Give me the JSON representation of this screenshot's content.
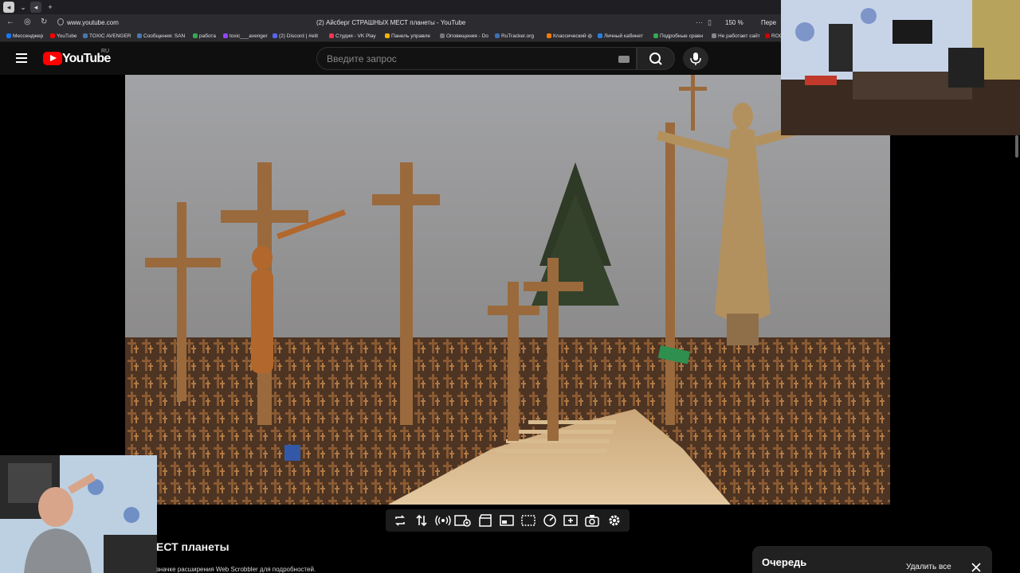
{
  "browser": {
    "url": "www.youtube.com",
    "tab_title": "(2) Айсберг СТРАШНЫХ МЕСТ планеты - YouTube",
    "zoom": "150 %",
    "extra_label": "Пере",
    "bookmarks": [
      {
        "label": "Мессенджер",
        "color": "#1877f2"
      },
      {
        "label": "YouTube",
        "color": "#ff0000"
      },
      {
        "label": "TOXIC AVENGER",
        "color": "#4a76a8"
      },
      {
        "label": "Сообщения: SAN",
        "color": "#4a76a8"
      },
      {
        "label": "работа",
        "color": "#34a853"
      },
      {
        "label": "toxic___avenger",
        "color": "#9146ff"
      },
      {
        "label": "(2) Discord | #elit",
        "color": "#5865f2"
      },
      {
        "label": "Студия - VK Play",
        "color": "#ff3355"
      },
      {
        "label": "Панель управле",
        "color": "#f4b400"
      },
      {
        "label": "Оповещения - Do",
        "color": "#777777"
      },
      {
        "label": "RuTracker.org",
        "color": "#3b6fb6"
      },
      {
        "label": "Классический ф",
        "color": "#ff7a00"
      },
      {
        "label": "Личный кабинет",
        "color": "#2a7de1"
      },
      {
        "label": "Подробные сравн",
        "color": "#34a853"
      },
      {
        "label": "Не работает сайт",
        "color": "#888888"
      },
      {
        "label": "ROG",
        "color": "#cc0000"
      }
    ]
  },
  "youtube": {
    "logo_text": "YouTube",
    "region": "RU",
    "search_placeholder": "Введите запрос"
  },
  "video": {
    "title_visible": "ЕСТ планеты",
    "scrobbler_note": "значке расширения Web Scrobbler для подробностей."
  },
  "toolbar": {
    "icons": [
      "loop-icon",
      "sort-icon",
      "broadcast-icon",
      "view-icon",
      "clapperboard-icon",
      "pip-icon",
      "cinema-icon",
      "speed-icon",
      "add-frame-icon",
      "screenshot-icon",
      "settings-icon"
    ]
  },
  "queue": {
    "title": "Очередь",
    "clear_label": "Удалить все"
  },
  "colors": {
    "yt_red": "#ff0000",
    "yt_bg": "#0f0f0f",
    "chrome_bg": "#2b2b30"
  }
}
